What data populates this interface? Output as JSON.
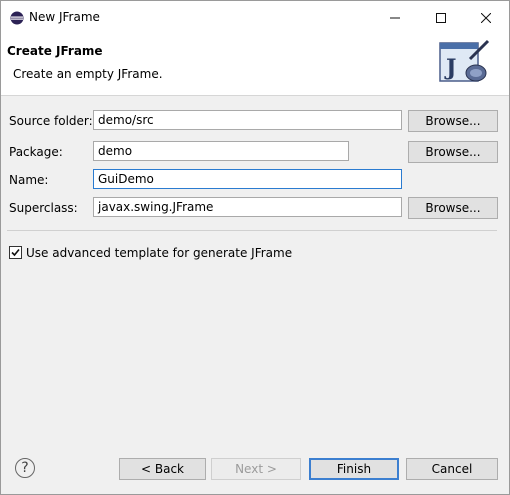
{
  "window": {
    "title": "New JFrame"
  },
  "banner": {
    "title": "Create JFrame",
    "description": "Create an empty JFrame."
  },
  "form": {
    "source_folder": {
      "label": "Source folder:",
      "value": "demo/src",
      "browse": "Browse..."
    },
    "package": {
      "label": "Package:",
      "value": "demo",
      "browse": "Browse..."
    },
    "name": {
      "label": "Name:",
      "value": "GuiDemo"
    },
    "superclass": {
      "label": "Superclass:",
      "value": "javax.swing.JFrame",
      "browse": "Browse..."
    }
  },
  "options": {
    "advanced_template_label": "Use advanced template for generate JFrame",
    "advanced_template_checked": true
  },
  "footer": {
    "back": "< Back",
    "next": "Next >",
    "finish": "Finish",
    "cancel": "Cancel"
  },
  "icons": {
    "app": "eclipse-icon",
    "banner": "java-bean-icon",
    "help": "help-icon"
  }
}
